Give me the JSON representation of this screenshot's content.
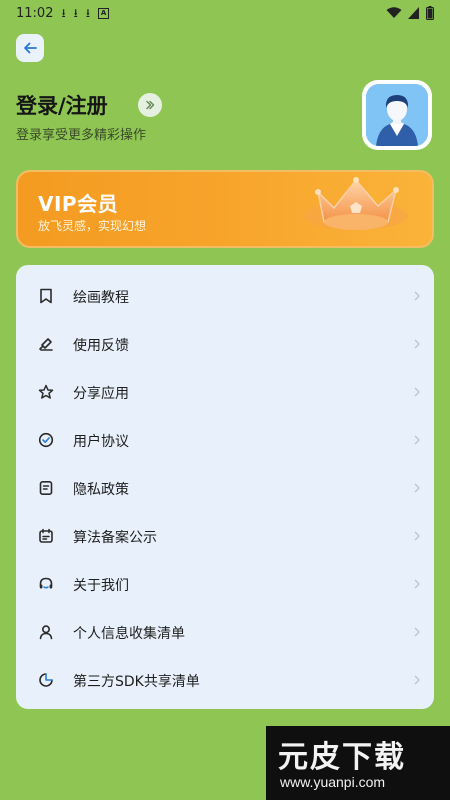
{
  "status_bar": {
    "time": "11:02",
    "download_glyph": "⭳",
    "app_glyph": "A"
  },
  "header": {
    "login_title": "登录/注册",
    "login_subtitle": "登录享受更多精彩操作"
  },
  "vip": {
    "title": "VIP会员",
    "subtitle": "放飞灵感，实现幻想"
  },
  "menu": {
    "items": [
      {
        "label": "绘画教程",
        "icon": "bookmark-icon"
      },
      {
        "label": "使用反馈",
        "icon": "feedback-icon"
      },
      {
        "label": "分享应用",
        "icon": "star-icon"
      },
      {
        "label": "用户协议",
        "icon": "check-circle-icon"
      },
      {
        "label": "隐私政策",
        "icon": "document-icon"
      },
      {
        "label": "算法备案公示",
        "icon": "calendar-icon"
      },
      {
        "label": "关于我们",
        "icon": "headset-icon"
      },
      {
        "label": "个人信息收集清单",
        "icon": "person-icon"
      },
      {
        "label": "第三方SDK共享清单",
        "icon": "pie-icon"
      }
    ]
  },
  "watermark": {
    "main": "元皮下载",
    "url": "www.yuanpi.com"
  },
  "colors": {
    "background": "#8fc653",
    "vip_orange": "#f49b21",
    "menu_card": "#e8f1fb"
  }
}
